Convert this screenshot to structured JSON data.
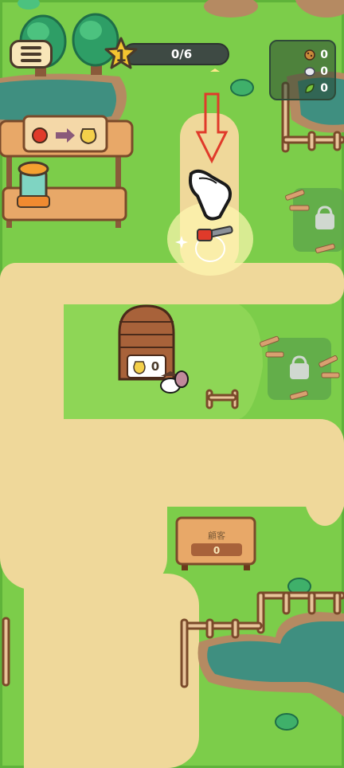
{
  "hud": {
    "level": "1",
    "progress_text": "0/6",
    "progress_fraction": 0.0
  },
  "resources": [
    {
      "icon": "cookie-icon",
      "value": "0",
      "color": "#c98a3a"
    },
    {
      "icon": "wool-icon",
      "value": "0",
      "color": "#e8e8f0"
    },
    {
      "icon": "leaf-icon",
      "value": "0",
      "color": "#7ac43a"
    }
  ],
  "juice_shop": {
    "sign_from_icon": "apple-icon",
    "sign_arrow_icon": "arrow-right-icon",
    "sign_to_icon": "juice-jar-icon"
  },
  "barn": {
    "jar_count": "0"
  },
  "customers_sign": {
    "title": "顧客",
    "count": "0"
  },
  "tutorial": {
    "arrow_icon": "arrow-down-icon",
    "hand_icon": "pointing-hand-icon",
    "target_icon": "chainsaw-icon"
  },
  "locks": [
    "lock-icon",
    "lock-icon"
  ],
  "colors": {
    "grass": "#7ccd4a",
    "grass_light": "#9ad85e",
    "path": "#efd89a",
    "wood": "#c8824a",
    "water": "#3f8f80",
    "hud_dark": "#3e4a44",
    "star": "#f4c430"
  }
}
